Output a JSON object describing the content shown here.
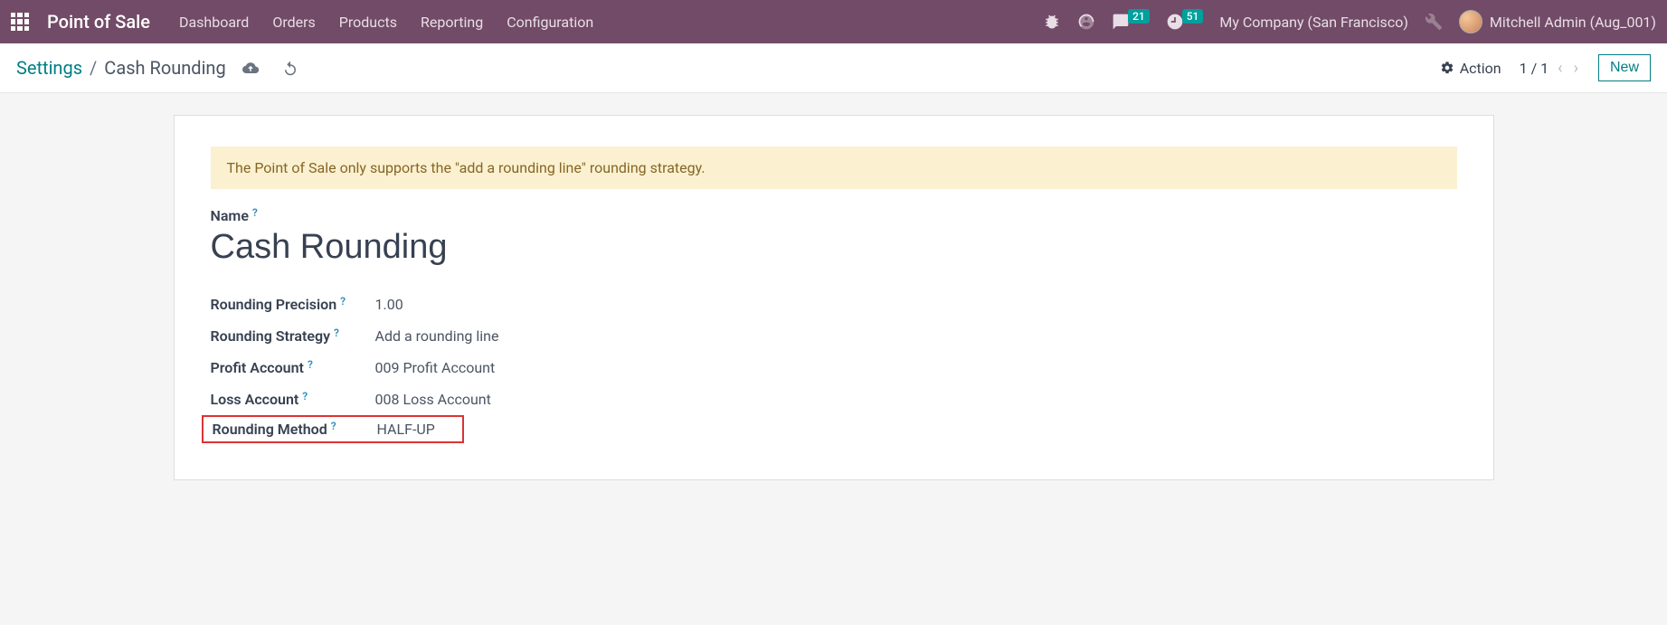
{
  "navbar": {
    "brand": "Point of Sale",
    "menu": [
      "Dashboard",
      "Orders",
      "Products",
      "Reporting",
      "Configuration"
    ],
    "messages_badge": "21",
    "activities_badge": "51",
    "company": "My Company (San Francisco)",
    "user": "Mitchell Admin (Aug_001)"
  },
  "controlbar": {
    "breadcrumb_root": "Settings",
    "breadcrumb_leaf": "Cash Rounding",
    "action_label": "Action",
    "pager": "1 / 1",
    "new_label": "New"
  },
  "form": {
    "alert": "The Point of Sale only supports the \"add a rounding line\" rounding strategy.",
    "name_label": "Name",
    "name_value": "Cash Rounding",
    "fields": {
      "rounding_precision": {
        "label": "Rounding Precision",
        "value": "1.00"
      },
      "rounding_strategy": {
        "label": "Rounding Strategy",
        "value": "Add a rounding line"
      },
      "profit_account": {
        "label": "Profit Account",
        "value": "009 Profit Account"
      },
      "loss_account": {
        "label": "Loss Account",
        "value": "008 Loss Account"
      },
      "rounding_method": {
        "label": "Rounding Method",
        "value": "HALF-UP"
      }
    }
  }
}
